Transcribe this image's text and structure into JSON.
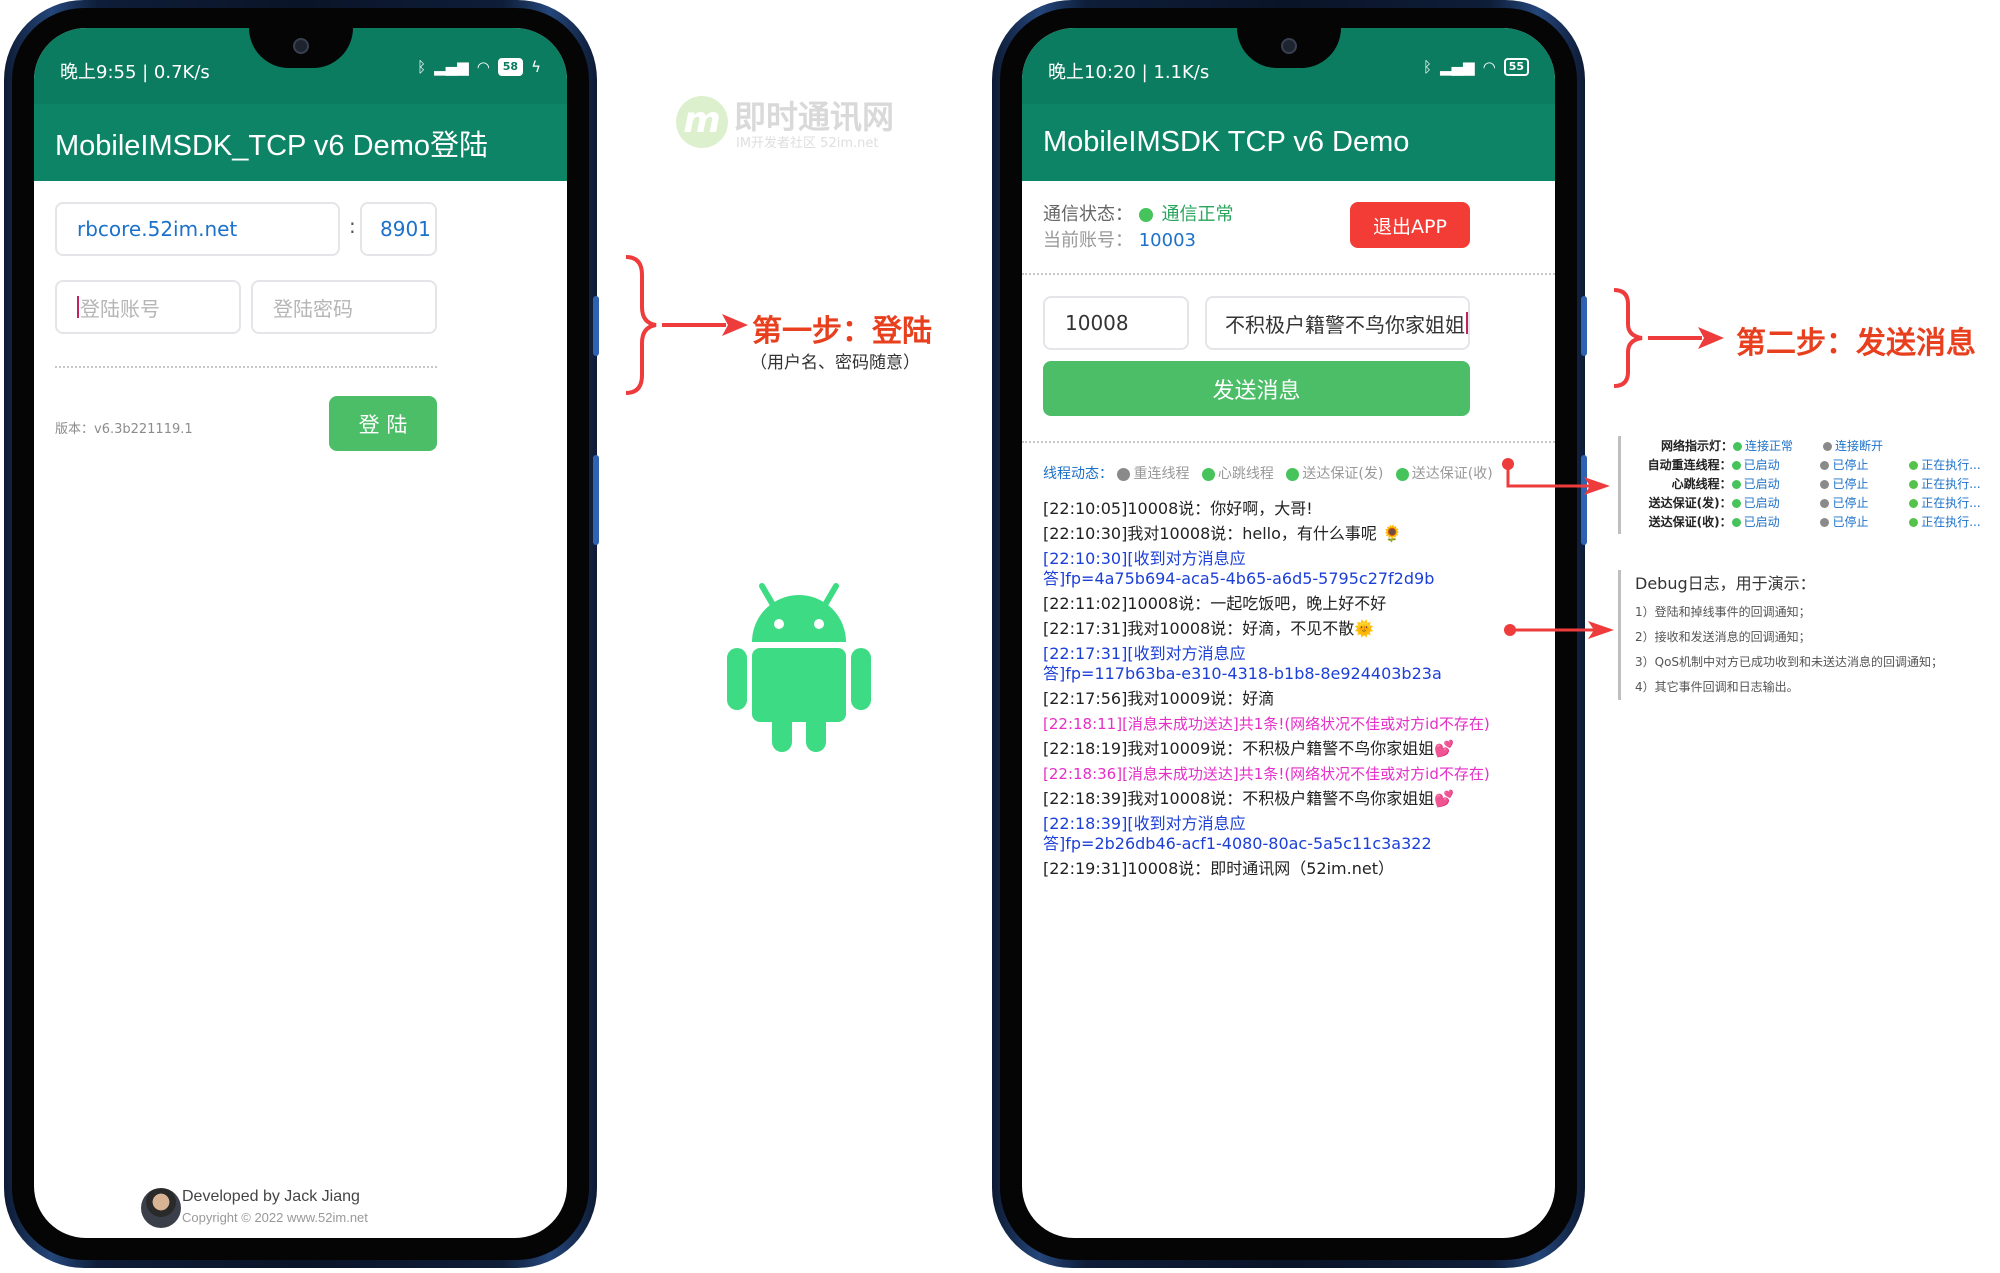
{
  "left_phone": {
    "status": {
      "time": "晚上9:55 | 0.7K/s",
      "battery": "58"
    },
    "title": "MobileIMSDK_TCP v6 Demo登陆",
    "server_host": "rbcore.52im.net",
    "separator": ":",
    "server_port": "8901",
    "account_placeholder": "登陆账号",
    "password_placeholder": "登陆密码",
    "version": "版本：v6.3b221119.1",
    "login_button": "登 陆",
    "footer_title": "Developed by Jack Jiang",
    "footer_copyright": "Copyright © 2022 www.52im.net"
  },
  "right_phone": {
    "status": {
      "time": "晚上10:20 | 1.1K/s",
      "battery": "55"
    },
    "title": "MobileIMSDK TCP v6 Demo",
    "conn_label": "通信状态：",
    "conn_value": "通信正常",
    "account_label": "当前账号：",
    "account_value": "10003",
    "exit_button": "退出APP",
    "to_user": "10008",
    "message": "不积极户籍警不鸟你家姐姐💕",
    "send_button": "发送消息",
    "threads_label": "线程动态：",
    "threads": [
      "重连线程",
      "心跳线程",
      "送达保证(发)",
      "送达保证(收)"
    ],
    "log": [
      {
        "text": "[22:10:05]10008说：你好啊，大哥!",
        "style": "normal"
      },
      {
        "text": "[22:10:30]我对10008说：hello，有什么事呢 🌻",
        "style": "normal"
      },
      {
        "text": "[22:10:30][收到对方消息应",
        "style": "blue"
      },
      {
        "text": "答]fp=4a75b694-aca5-4b65-a6d5-5795c27f2d9b",
        "style": "blue"
      },
      {
        "text": "[22:11:02]10008说：一起吃饭吧，晚上好不好",
        "style": "normal"
      },
      {
        "text": "[22:17:31]我对10008说：好滴，不见不散🌞",
        "style": "normal"
      },
      {
        "text": "[22:17:31][收到对方消息应",
        "style": "blue"
      },
      {
        "text": "答]fp=117b63ba-e310-4318-b1b8-8e924403b23a",
        "style": "blue"
      },
      {
        "text": "[22:17:56]我对10009说：好滴",
        "style": "normal"
      },
      {
        "text": "[22:18:11][消息未成功送达]共1条!(网络状况不佳或对方id不存在)",
        "style": "pink"
      },
      {
        "text": "[22:18:19]我对10009说：不积极户籍警不鸟你家姐姐💕",
        "style": "normal"
      },
      {
        "text": "[22:18:36][消息未成功送达]共1条!(网络状况不佳或对方id不存在)",
        "style": "pink"
      },
      {
        "text": "[22:18:39]我对10008说：不积极户籍警不鸟你家姐姐💕",
        "style": "normal"
      },
      {
        "text": "[22:18:39][收到对方消息应",
        "style": "blue"
      },
      {
        "text": "答]fp=2b26db46-acf1-4080-80ac-5a5c11c3a322",
        "style": "blue"
      },
      {
        "text": "[22:19:31]10008说：即时通讯网（52im.net）",
        "style": "normal"
      }
    ]
  },
  "annotations": {
    "step1_title": "第一步：登陆",
    "step1_sub": "（用户名、密码随意）",
    "step2_title": "第二步：发送消息",
    "watermark_title": "即时通讯网",
    "watermark_sub": "IM开发者社区 52im.net"
  },
  "status_panel": {
    "rows": [
      {
        "label": "网络指示灯：",
        "a": "连接正常",
        "b": "连接断开",
        "c": ""
      },
      {
        "label": "自动重连线程：",
        "a": "已启动",
        "b": "已停止",
        "c": "正在执行..."
      },
      {
        "label": "心跳线程：",
        "a": "已启动",
        "b": "已停止",
        "c": "正在执行..."
      },
      {
        "label": "送达保证(发)：",
        "a": "已启动",
        "b": "已停止",
        "c": "正在执行..."
      },
      {
        "label": "送达保证(收)：",
        "a": "已启动",
        "b": "已停止",
        "c": "正在执行..."
      }
    ]
  },
  "debug_panel": {
    "title": "Debug日志，用于演示：",
    "items": [
      "1）登陆和掉线事件的回调通知；",
      "2）接收和发送消息的回调通知；",
      "3）QoS机制中对方已成功收到和未送达消息的回调通知；",
      "4）其它事件回调和日志输出。"
    ]
  },
  "colors": {
    "brand": "#0e8467",
    "statusbar": "#0b7c5f",
    "green_button": "#4cbe68",
    "exit_red": "#f23c35",
    "annotation_red": "#e8401f",
    "arrow_red": "#ee3b3b"
  }
}
